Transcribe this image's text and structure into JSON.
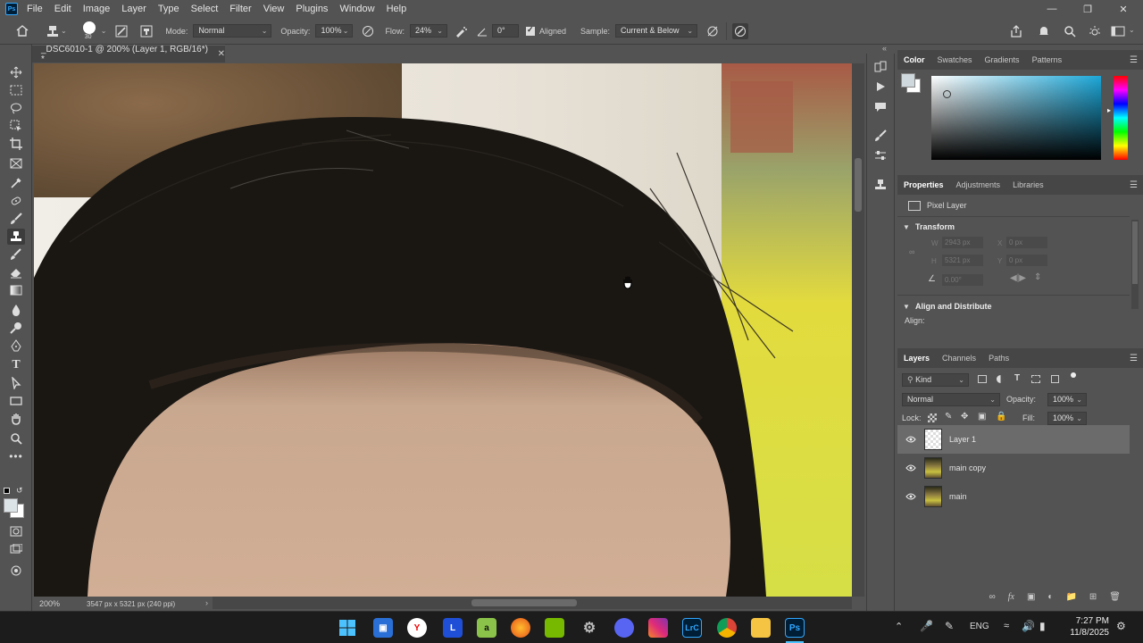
{
  "app": {
    "logo": "Ps",
    "menu": [
      "File",
      "Edit",
      "Image",
      "Layer",
      "Type",
      "Select",
      "Filter",
      "View",
      "Plugins",
      "Window",
      "Help"
    ],
    "window_controls": [
      "minimize-icon",
      "restore-icon",
      "close-icon"
    ]
  },
  "options": {
    "brush_size": "30",
    "mode_label": "Mode:",
    "mode_value": "Normal",
    "opacity_label": "Opacity:",
    "opacity_value": "100%",
    "flow_label": "Flow:",
    "flow_value": "24%",
    "angle_value": "0°",
    "aligned_label": "Aligned",
    "aligned_checked": true,
    "sample_label": "Sample:",
    "sample_value": "Current & Below"
  },
  "document": {
    "tab_title": "_DSC6010-1 @ 200% (Layer 1, RGB/16*) *",
    "zoom": "200%",
    "info": "3547 px x 5321 px (240 ppi)"
  },
  "color_panel": {
    "tabs": [
      "Color",
      "Swatches",
      "Gradients",
      "Patterns"
    ],
    "active_tab": "Color",
    "foreground": "#ffffff",
    "background": "#cfd8dc"
  },
  "properties_panel": {
    "tabs": [
      "Properties",
      "Adjustments",
      "Libraries"
    ],
    "active_tab": "Properties",
    "type_label": "Pixel Layer",
    "transform_heading": "Transform",
    "w_label": "W",
    "w_value": "2943 px",
    "h_label": "H",
    "h_value": "5321 px",
    "x_label": "X",
    "x_value": "0 px",
    "y_label": "Y",
    "y_value": "0 px",
    "angle_value": "0.00°",
    "align_heading": "Align and Distribute",
    "align_label": "Align:"
  },
  "layers_panel": {
    "tabs": [
      "Layers",
      "Channels",
      "Paths"
    ],
    "active_tab": "Layers",
    "filter_kind": "Kind",
    "blend_mode": "Normal",
    "opacity_label": "Opacity:",
    "opacity_value": "100%",
    "lock_label": "Lock:",
    "fill_label": "Fill:",
    "fill_value": "100%",
    "layers": [
      {
        "name": "Layer 1",
        "selected": true
      },
      {
        "name": "main copy",
        "selected": false
      },
      {
        "name": "main",
        "selected": false
      }
    ]
  },
  "taskbar": {
    "apps": [
      "windows-start-icon",
      "store-icon",
      "yandex-icon",
      "l-app-icon",
      "a-app-icon",
      "firefox-icon",
      "nvidia-icon",
      "settings-icon",
      "discord-icon",
      "instagram-icon",
      "lightroom-icon",
      "chrome-icon",
      "file-explorer-icon",
      "photoshop-icon"
    ],
    "lightroom_label": "LrC",
    "photoshop_label": "Ps",
    "lang": "ENG",
    "time": "7:27 PM",
    "date": "11/8/2025"
  }
}
